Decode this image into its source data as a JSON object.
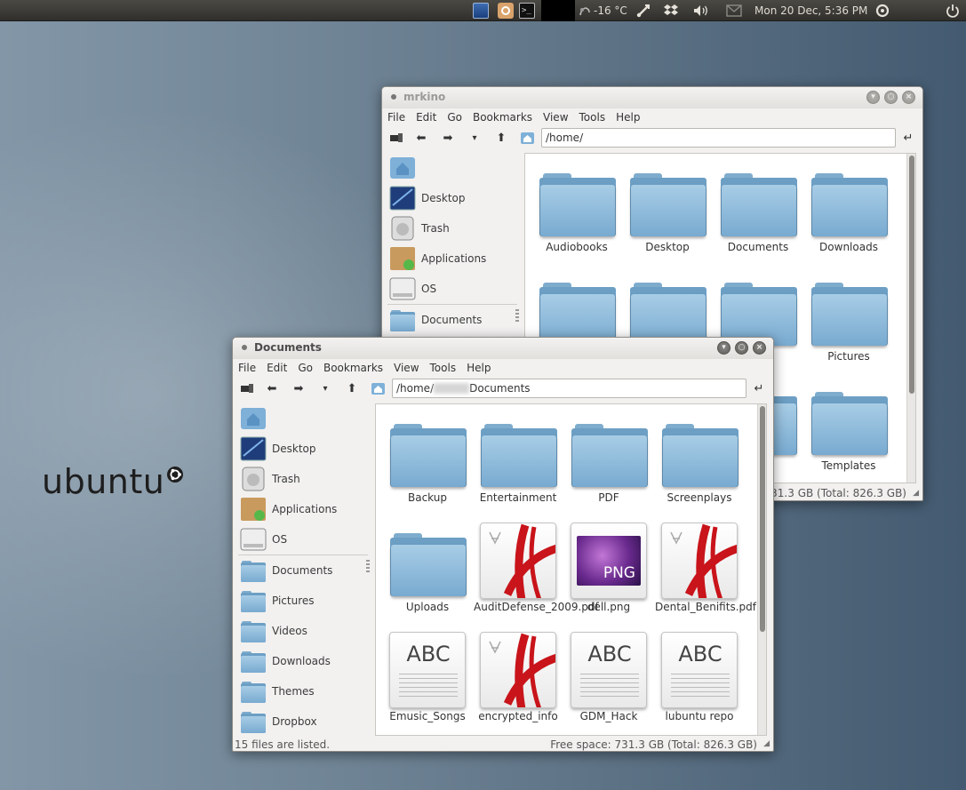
{
  "panel": {
    "temperature": "-16 °C",
    "datetime": "Mon 20 Dec,  5:36 PM"
  },
  "desktop": {
    "logo_text": "ubuntu"
  },
  "mrkino": {
    "title": "mrkino",
    "menu": [
      "File",
      "Edit",
      "Go",
      "Bookmarks",
      "View",
      "Tools",
      "Help"
    ],
    "location": "/home/",
    "sidebar": [
      {
        "label": "",
        "icon": "home-icon"
      },
      {
        "label": "Desktop",
        "icon": "desktop-icon"
      },
      {
        "label": "Trash",
        "icon": "trash-icon"
      },
      {
        "label": "Applications",
        "icon": "applications-icon"
      },
      {
        "label": "OS",
        "icon": "drive-icon"
      },
      {
        "label": "Documents",
        "icon": "folder-icon"
      }
    ],
    "files": [
      {
        "label": "Audiobooks"
      },
      {
        "label": "Desktop"
      },
      {
        "label": "Documents"
      },
      {
        "label": "Downloads"
      },
      {
        "label": ""
      },
      {
        "label": ""
      },
      {
        "label": ""
      },
      {
        "label": "Pictures"
      },
      {
        "label": ""
      },
      {
        "label": ""
      },
      {
        "label": ""
      },
      {
        "label": "Templates"
      }
    ],
    "status_right": "731.3 GB (Total: 826.3 GB)"
  },
  "documents": {
    "title": "Documents",
    "menu": [
      "File",
      "Edit",
      "Go",
      "Bookmarks",
      "View",
      "Tools",
      "Help"
    ],
    "location_prefix": "/home/",
    "location_suffix": "Documents",
    "sidebar": [
      {
        "label": "",
        "icon": "home-icon"
      },
      {
        "label": "Desktop",
        "icon": "desktop-icon"
      },
      {
        "label": "Trash",
        "icon": "trash-icon"
      },
      {
        "label": "Applications",
        "icon": "applications-icon"
      },
      {
        "label": "OS",
        "icon": "drive-icon"
      },
      {
        "label": "Documents",
        "icon": "folder-icon"
      },
      {
        "label": "Pictures",
        "icon": "folder-icon"
      },
      {
        "label": "Videos",
        "icon": "folder-icon"
      },
      {
        "label": "Downloads",
        "icon": "folder-icon"
      },
      {
        "label": "Themes",
        "icon": "folder-icon"
      },
      {
        "label": "Dropbox",
        "icon": "folder-icon"
      }
    ],
    "files": [
      {
        "label": "Backup",
        "type": "folder"
      },
      {
        "label": "Entertainment",
        "type": "folder"
      },
      {
        "label": "PDF",
        "type": "folder"
      },
      {
        "label": "Screenplays",
        "type": "folder"
      },
      {
        "label": "Uploads",
        "type": "folder"
      },
      {
        "label": "AuditDefense_2009.pdf",
        "type": "pdf"
      },
      {
        "label": "dell.png",
        "type": "png"
      },
      {
        "label": "Dental_Benifits.pdf",
        "type": "pdf"
      },
      {
        "label": "Emusic_Songs",
        "type": "text"
      },
      {
        "label": "encrypted_info",
        "type": "pdf"
      },
      {
        "label": "GDM_Hack",
        "type": "text"
      },
      {
        "label": "lubuntu repo",
        "type": "text"
      }
    ],
    "text_icon_label": "ABC",
    "png_badge": "PNG",
    "status_left": "15 files are listed.",
    "status_right": "Free space: 731.3 GB (Total: 826.3 GB)"
  },
  "colors": {
    "folder": "#8ab8da",
    "pdf_red": "#c8141a",
    "panel": "#3c3b37"
  }
}
